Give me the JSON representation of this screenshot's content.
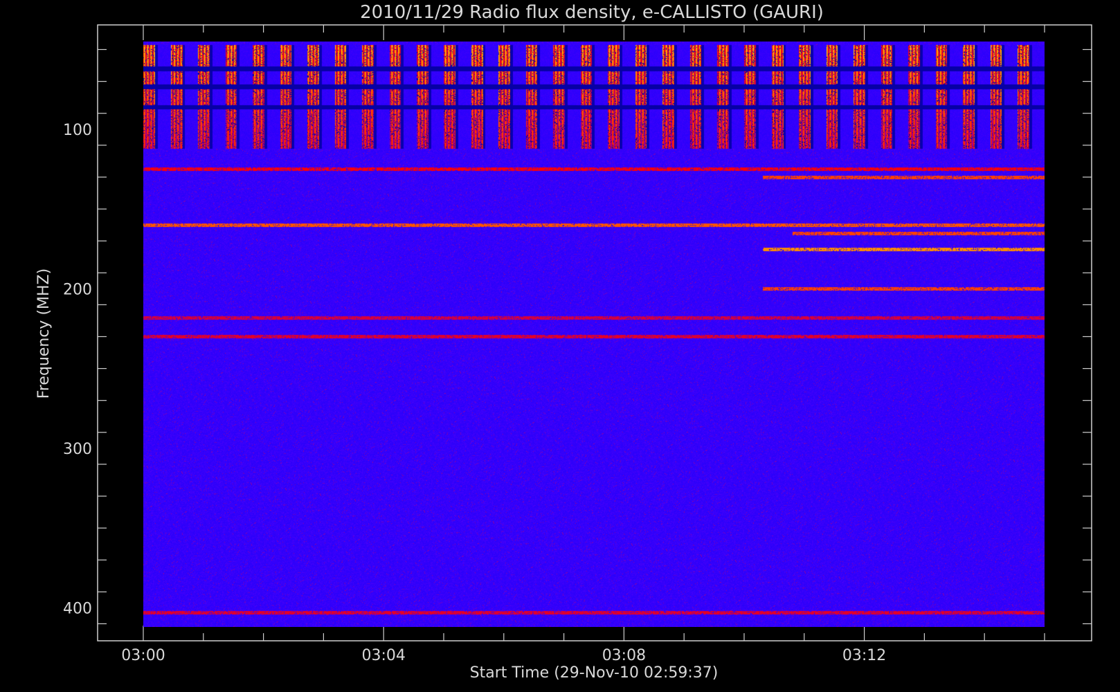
{
  "chart_data": {
    "type": "heatmap",
    "title": "2010/11/29  Radio flux density, e-CALLISTO (GAURI)",
    "xlabel": "Start Time (29-Nov-10 02:59:37)",
    "ylabel": "Frequency (MHZ)",
    "x_range_minutes": [
      0,
      15
    ],
    "x_ticks": [
      {
        "value": 0,
        "label": "03:00"
      },
      {
        "value": 4,
        "label": "03:04"
      },
      {
        "value": 8,
        "label": "03:08"
      },
      {
        "value": 12,
        "label": "03:12"
      }
    ],
    "ylim": [
      45,
      412
    ],
    "y_ticks": [
      {
        "value": 100,
        "label": "100"
      },
      {
        "value": 200,
        "label": "200"
      },
      {
        "value": 300,
        "label": "300"
      },
      {
        "value": 400,
        "label": "400"
      }
    ],
    "colorscale": [
      "#000000",
      "#1f00ff",
      "#3a00ff",
      "#ff0000",
      "#ffa500",
      "#ffff80"
    ],
    "features": {
      "bursts_freq_range_mhz": [
        47,
        112
      ],
      "burst_count": 33,
      "emission_lines": [
        {
          "freq_mhz": 125,
          "start_min": 0,
          "end_min": 15,
          "intensity": 0.6
        },
        {
          "freq_mhz": 130,
          "start_min": 10.3,
          "end_min": 15,
          "intensity": 0.8
        },
        {
          "freq_mhz": 160,
          "start_min": 0,
          "end_min": 15,
          "intensity": 0.85
        },
        {
          "freq_mhz": 165,
          "start_min": 10.8,
          "end_min": 15,
          "intensity": 0.8
        },
        {
          "freq_mhz": 175,
          "start_min": 10.3,
          "end_min": 15,
          "intensity": 1.0
        },
        {
          "freq_mhz": 200,
          "start_min": 10.3,
          "end_min": 15,
          "intensity": 0.8
        },
        {
          "freq_mhz": 218,
          "start_min": 0,
          "end_min": 15,
          "intensity": 0.45
        },
        {
          "freq_mhz": 230,
          "start_min": 0,
          "end_min": 15,
          "intensity": 0.5
        },
        {
          "freq_mhz": 403,
          "start_min": 0,
          "end_min": 15,
          "intensity": 0.5
        }
      ]
    }
  }
}
